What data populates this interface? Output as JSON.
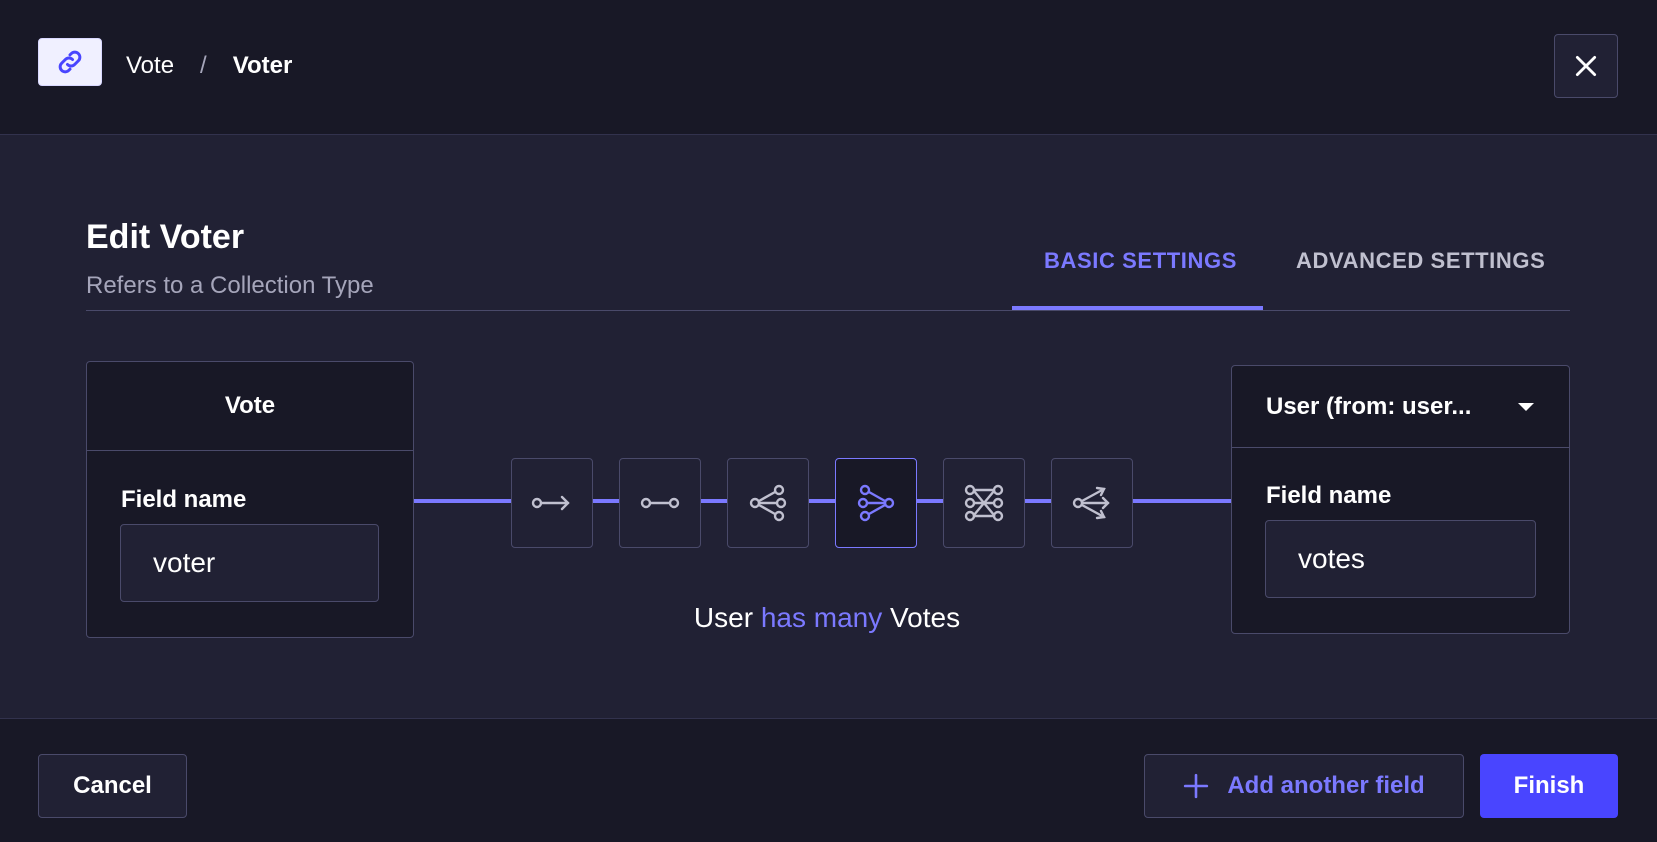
{
  "header": {
    "breadcrumb_parent": "Vote",
    "breadcrumb_separator": "/",
    "breadcrumb_current": "Voter",
    "link_icon": "link-icon",
    "close_icon": "close-icon"
  },
  "modal": {
    "title": "Edit Voter",
    "subtitle": "Refers to a Collection Type",
    "tabs": [
      {
        "label": "BASIC SETTINGS",
        "active": true
      },
      {
        "label": "ADVANCED SETTINGS",
        "active": false
      }
    ]
  },
  "left_box": {
    "header": "Vote",
    "field_label": "Field name",
    "field_value": "voter"
  },
  "right_box": {
    "select_value": "User (from: user...",
    "field_label": "Field name",
    "field_value": "votes"
  },
  "relations": [
    {
      "icon": "one-way-icon",
      "active": false
    },
    {
      "icon": "one-to-one-icon",
      "active": false
    },
    {
      "icon": "one-to-many-icon",
      "active": false
    },
    {
      "icon": "many-to-one-icon",
      "active": true
    },
    {
      "icon": "many-to-many-icon",
      "active": false
    },
    {
      "icon": "many-way-icon",
      "active": false
    }
  ],
  "relation_text": {
    "subject": "User",
    "verb": "has many",
    "object": "Votes"
  },
  "footer": {
    "cancel_label": "Cancel",
    "add_field_label": "Add another field",
    "finish_label": "Finish"
  },
  "colors": {
    "accent": "#7b79ff",
    "primary_button": "#4945ff",
    "background": "#212134",
    "panel": "#181826"
  }
}
